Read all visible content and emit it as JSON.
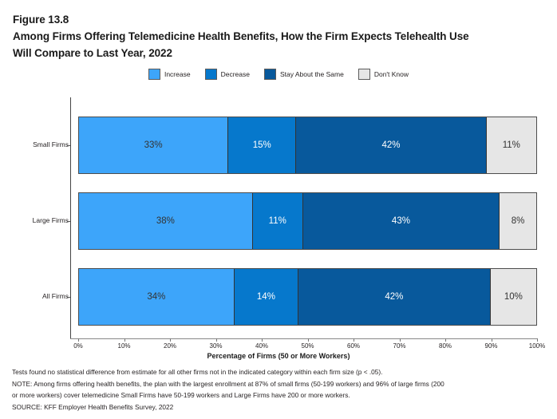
{
  "figure": {
    "number": "Figure 13.8",
    "title_line1": "Among Firms Offering Telemedicine Health Benefits, How the Firm Expects Telehealth Use",
    "title_line2": "Will Compare to Last Year, 2022"
  },
  "colors": {
    "increase": "#3DA5FA",
    "decrease": "#0678CC",
    "stay_about_the_same": "#08599C",
    "dont_know": "#E6E6E6",
    "bar_border": "#4D4D4D",
    "axis": "#555555"
  },
  "footnotes": [
    "Tests found no statistical difference from estimate for all other firms not in the indicated category within each firm size (p < .05).",
    "NOTE: Among firms offering health benefits, the plan with the largest enrollment at 87% of small firms (50-199 workers) and 96% of large firms (200",
    "or more workers) cover telemedicine Small Firms have 50-199 workers and Large Firms have 200 or more workers.",
    "SOURCE: KFF Employer Health Benefits Survey, 2022"
  ],
  "chart_data": {
    "type": "bar",
    "orientation": "horizontal",
    "stacked": true,
    "stacked_percent": true,
    "title": "Among Firms Offering Telemedicine Health Benefits, How the Firm Expects Telehealth Use Will Compare to Last Year, 2022",
    "xlabel": "Percentage of Firms (50 or More Workers)",
    "ylabel": "",
    "xlim": [
      0,
      100
    ],
    "xticks": [
      0,
      10,
      20,
      30,
      40,
      50,
      60,
      70,
      80,
      90,
      100
    ],
    "xtick_labels": [
      "0%",
      "10%",
      "20%",
      "30%",
      "40%",
      "50%",
      "60%",
      "70%",
      "80%",
      "90%",
      "100%"
    ],
    "grid": false,
    "legend_position": "top-center",
    "categories": [
      "Small Firms",
      "Large Firms",
      "All Firms"
    ],
    "series": [
      {
        "name": "Increase",
        "color": "#3DA5FA",
        "values": [
          33,
          38,
          34
        ],
        "labels": [
          "33%",
          "38%",
          "34%"
        ]
      },
      {
        "name": "Decrease",
        "color": "#0678CC",
        "values": [
          15,
          11,
          14
        ],
        "labels": [
          "15%",
          "11%",
          "14%"
        ]
      },
      {
        "name": "Stay About the Same",
        "color": "#08599C",
        "values": [
          42,
          43,
          42
        ],
        "labels": [
          "42%",
          "43%",
          "42%"
        ]
      },
      {
        "name": "Don't Know",
        "color": "#E6E6E6",
        "values": [
          11,
          8,
          10
        ],
        "labels": [
          "11%",
          "8%",
          "10%"
        ]
      }
    ]
  }
}
